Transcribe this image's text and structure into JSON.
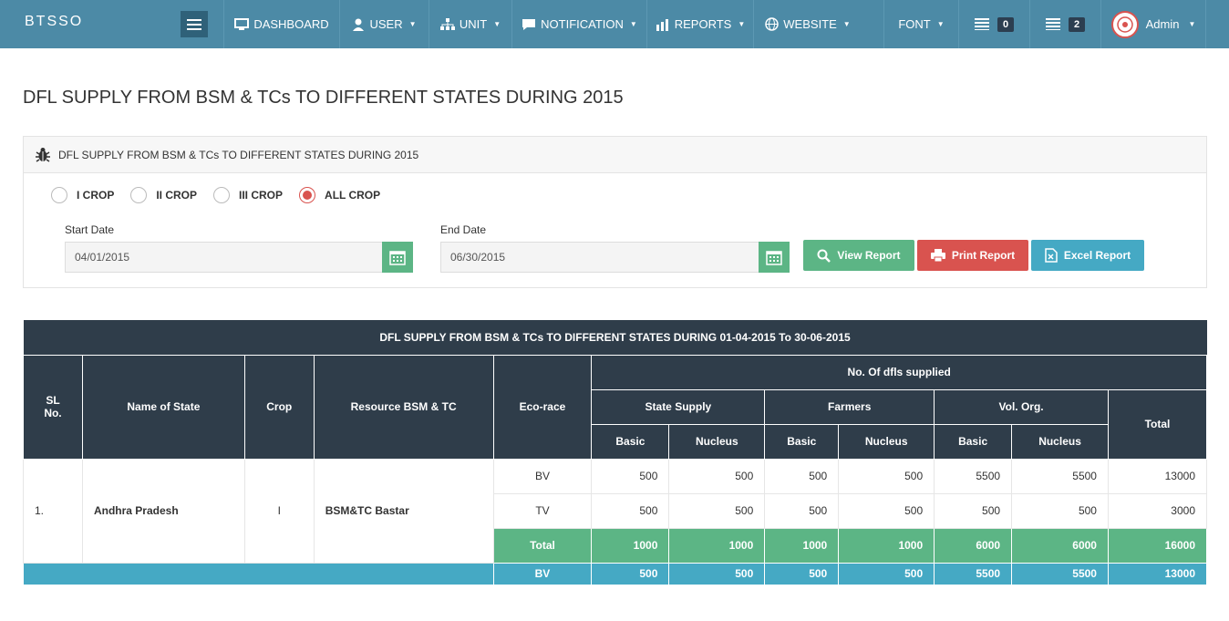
{
  "brand": "BTSSO",
  "nav": {
    "dashboard": "DASHBOARD",
    "user": "USER",
    "unit": "UNIT",
    "notification": "NOTIFICATION",
    "reports": "REPORTS",
    "website": "WEBSITE",
    "font": "FONT",
    "badge1": "0",
    "badge2": "2",
    "admin": "Admin"
  },
  "page_title": "DFL SUPPLY FROM BSM & TCs TO DIFFERENT STATES DURING 2015",
  "panel": {
    "title": "DFL SUPPLY FROM BSM & TCs TO DIFFERENT STATES DURING 2015",
    "radios": [
      {
        "label": "I CROP",
        "selected": false
      },
      {
        "label": "II CROP",
        "selected": false
      },
      {
        "label": "III CROP",
        "selected": false
      },
      {
        "label": "ALL CROP",
        "selected": true
      }
    ],
    "start_label": "Start Date",
    "start_value": "04/01/2015",
    "end_label": "End Date",
    "end_value": "06/30/2015",
    "view_btn": "View Report",
    "print_btn": "Print Report",
    "excel_btn": "Excel Report"
  },
  "table": {
    "caption": "DFL SUPPLY FROM BSM & TCs TO DIFFERENT STATES DURING 01-04-2015 To 30-06-2015",
    "h_sl": "SL No.",
    "h_state": "Name of State",
    "h_crop": "Crop",
    "h_resource": "Resource BSM & TC",
    "h_eco": "Eco-race",
    "h_nodfl": "No. Of dfls supplied",
    "h_state_supply": "State Supply",
    "h_farmers": "Farmers",
    "h_vol": "Vol. Org.",
    "h_total": "Total",
    "h_basic": "Basic",
    "h_nucleus": "Nucleus",
    "row": {
      "sl": "1.",
      "state": "Andhra Pradesh",
      "crop": "I",
      "resource": "BSM&TC Bastar"
    },
    "bv": {
      "eco": "BV",
      "v": [
        "500",
        "500",
        "500",
        "500",
        "5500",
        "5500",
        "13000"
      ]
    },
    "tv": {
      "eco": "TV",
      "v": [
        "500",
        "500",
        "500",
        "500",
        "500",
        "500",
        "3000"
      ]
    },
    "total": {
      "eco": "Total",
      "v": [
        "1000",
        "1000",
        "1000",
        "1000",
        "6000",
        "6000",
        "16000"
      ]
    },
    "grand_bv": {
      "eco": "BV",
      "v": [
        "500",
        "500",
        "500",
        "500",
        "5500",
        "5500",
        "13000"
      ]
    }
  },
  "colors": {
    "navbar": "#4c8aa6",
    "table_header": "#2f3d4a",
    "green": "#5cb585",
    "red": "#d9534f",
    "blue": "#45a9c4"
  }
}
